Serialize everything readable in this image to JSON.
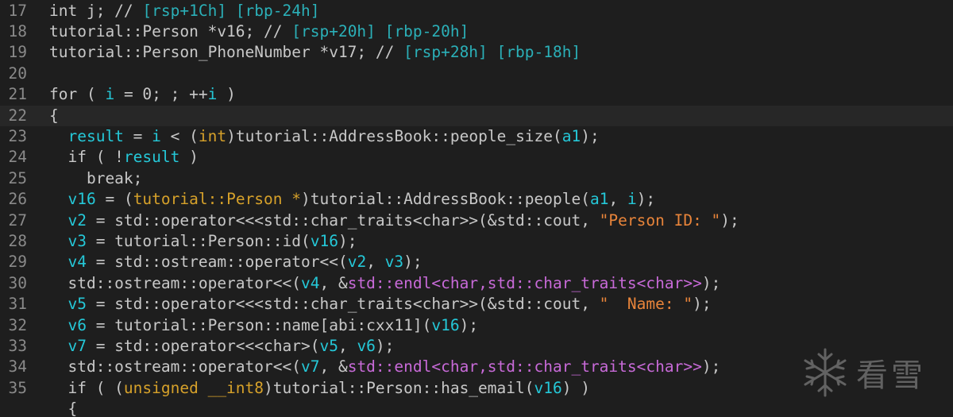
{
  "editor": {
    "lines": [
      {
        "num": "17",
        "segments": [
          {
            "t": "int j; // ",
            "c": "d"
          },
          {
            "t": "[rsp+1Ch] [rbp-24h]",
            "c": "c"
          }
        ]
      },
      {
        "num": "18",
        "segments": [
          {
            "t": "tutorial::Person *v16; // ",
            "c": "d"
          },
          {
            "t": "[rsp+20h] [rbp-20h]",
            "c": "c"
          }
        ]
      },
      {
        "num": "19",
        "segments": [
          {
            "t": "tutorial::Person_PhoneNumber *v17; // ",
            "c": "d"
          },
          {
            "t": "[rsp+28h] [rbp-18h]",
            "c": "c"
          }
        ]
      },
      {
        "num": "20",
        "segments": []
      },
      {
        "num": "21",
        "segments": [
          {
            "t": "for ( ",
            "c": "d"
          },
          {
            "t": "i",
            "c": "v"
          },
          {
            "t": " = 0; ; ++",
            "c": "d"
          },
          {
            "t": "i",
            "c": "v"
          },
          {
            "t": " )",
            "c": "d"
          }
        ]
      },
      {
        "num": "22",
        "active": true,
        "segments": [
          {
            "t": "{",
            "c": "d"
          }
        ]
      },
      {
        "num": "23",
        "segments": [
          {
            "t": "  ",
            "c": "d"
          },
          {
            "t": "result",
            "c": "v"
          },
          {
            "t": " = ",
            "c": "d"
          },
          {
            "t": "i",
            "c": "v"
          },
          {
            "t": " < (",
            "c": "d"
          },
          {
            "t": "int",
            "c": "t"
          },
          {
            "t": ")tutorial::AddressBook::people_size(",
            "c": "d"
          },
          {
            "t": "a1",
            "c": "v"
          },
          {
            "t": ");",
            "c": "d"
          }
        ]
      },
      {
        "num": "24",
        "segments": [
          {
            "t": "  if ( !",
            "c": "d"
          },
          {
            "t": "result",
            "c": "v"
          },
          {
            "t": " )",
            "c": "d"
          }
        ]
      },
      {
        "num": "25",
        "segments": [
          {
            "t": "    break;",
            "c": "d"
          }
        ]
      },
      {
        "num": "26",
        "segments": [
          {
            "t": "  ",
            "c": "d"
          },
          {
            "t": "v16",
            "c": "v"
          },
          {
            "t": " = (",
            "c": "d"
          },
          {
            "t": "tutorial::Person *",
            "c": "t"
          },
          {
            "t": ")tutorial::AddressBook::people(",
            "c": "d"
          },
          {
            "t": "a1",
            "c": "v"
          },
          {
            "t": ", ",
            "c": "d"
          },
          {
            "t": "i",
            "c": "v"
          },
          {
            "t": ");",
            "c": "d"
          }
        ]
      },
      {
        "num": "27",
        "segments": [
          {
            "t": "  ",
            "c": "d"
          },
          {
            "t": "v2",
            "c": "v"
          },
          {
            "t": " = std::operator<<<std::char_traits<char>>(&std::cout, ",
            "c": "d"
          },
          {
            "t": "\"Person ID: \"",
            "c": "s"
          },
          {
            "t": ");",
            "c": "d"
          }
        ]
      },
      {
        "num": "28",
        "segments": [
          {
            "t": "  ",
            "c": "d"
          },
          {
            "t": "v3",
            "c": "v"
          },
          {
            "t": " = tutorial::Person::id(",
            "c": "d"
          },
          {
            "t": "v16",
            "c": "v"
          },
          {
            "t": ");",
            "c": "d"
          }
        ]
      },
      {
        "num": "29",
        "segments": [
          {
            "t": "  ",
            "c": "d"
          },
          {
            "t": "v4",
            "c": "v"
          },
          {
            "t": " = std::ostream::operator<<(",
            "c": "d"
          },
          {
            "t": "v2",
            "c": "v"
          },
          {
            "t": ", ",
            "c": "d"
          },
          {
            "t": "v3",
            "c": "v"
          },
          {
            "t": ");",
            "c": "d"
          }
        ]
      },
      {
        "num": "30",
        "segments": [
          {
            "t": "  std::ostream::operator<<(",
            "c": "d"
          },
          {
            "t": "v4",
            "c": "v"
          },
          {
            "t": ", &",
            "c": "d"
          },
          {
            "t": "std::endl<char,std::char_traits<char>>",
            "c": "m"
          },
          {
            "t": ");",
            "c": "d"
          }
        ]
      },
      {
        "num": "31",
        "segments": [
          {
            "t": "  ",
            "c": "d"
          },
          {
            "t": "v5",
            "c": "v"
          },
          {
            "t": " = std::operator<<<std::char_traits<char>>(&std::cout, ",
            "c": "d"
          },
          {
            "t": "\"  Name: \"",
            "c": "s"
          },
          {
            "t": ");",
            "c": "d"
          }
        ]
      },
      {
        "num": "32",
        "segments": [
          {
            "t": "  ",
            "c": "d"
          },
          {
            "t": "v6",
            "c": "v"
          },
          {
            "t": " = tutorial::Person::name[abi:cxx11](",
            "c": "d"
          },
          {
            "t": "v16",
            "c": "v"
          },
          {
            "t": ");",
            "c": "d"
          }
        ]
      },
      {
        "num": "33",
        "segments": [
          {
            "t": "  ",
            "c": "d"
          },
          {
            "t": "v7",
            "c": "v"
          },
          {
            "t": " = std::operator<<<char>(",
            "c": "d"
          },
          {
            "t": "v5",
            "c": "v"
          },
          {
            "t": ", ",
            "c": "d"
          },
          {
            "t": "v6",
            "c": "v"
          },
          {
            "t": ");",
            "c": "d"
          }
        ]
      },
      {
        "num": "34",
        "segments": [
          {
            "t": "  std::ostream::operator<<(",
            "c": "d"
          },
          {
            "t": "v7",
            "c": "v"
          },
          {
            "t": ", &",
            "c": "d"
          },
          {
            "t": "std::endl<char,std::char_traits<char>>",
            "c": "m"
          },
          {
            "t": ");",
            "c": "d"
          }
        ]
      },
      {
        "num": "35",
        "segments": [
          {
            "t": "  if ( (",
            "c": "d"
          },
          {
            "t": "unsigned __int8",
            "c": "t"
          },
          {
            "t": ")tutorial::Person::has_email(",
            "c": "d"
          },
          {
            "t": "v16",
            "c": "v"
          },
          {
            "t": ") )",
            "c": "d"
          }
        ]
      },
      {
        "num": "",
        "segments": [
          {
            "t": "  {",
            "c": "d"
          }
        ]
      }
    ]
  },
  "watermark": {
    "icon": "snowflake-icon",
    "text": "看雪"
  }
}
